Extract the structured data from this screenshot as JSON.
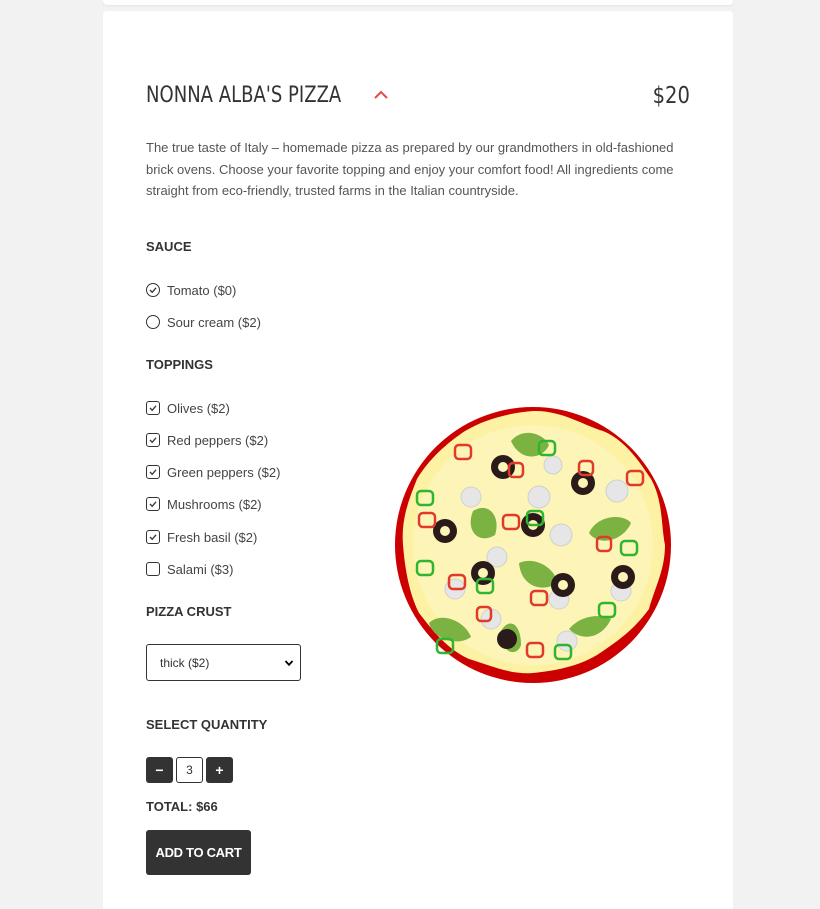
{
  "product": {
    "title": "NONNA ALBA'S PIZZA",
    "price": "$20",
    "description": "The true taste of Italy – homemade pizza as prepared by our grandmothers in old-fashioned brick ovens. Choose your favorite topping and enjoy your comfort food! All ingredients come straight from eco-friendly, trusted farms in the Italian countryside."
  },
  "sauce": {
    "label": "SAUCE",
    "options": [
      {
        "label": "Tomato ($0)",
        "selected": true
      },
      {
        "label": "Sour cream ($2)",
        "selected": false
      }
    ]
  },
  "toppings": {
    "label": "TOPPINGS",
    "options": [
      {
        "label": "Olives ($2)",
        "checked": true
      },
      {
        "label": "Red peppers ($2)",
        "checked": true
      },
      {
        "label": "Green peppers ($2)",
        "checked": true
      },
      {
        "label": "Mushrooms ($2)",
        "checked": true
      },
      {
        "label": "Fresh basil ($2)",
        "checked": true
      },
      {
        "label": "Salami ($3)",
        "checked": false
      }
    ]
  },
  "crust": {
    "label": "PIZZA CRUST",
    "selected": "thick ($2)"
  },
  "quantity": {
    "label": "SELECT QUANTITY",
    "value": "3",
    "minus": "−",
    "plus": "+"
  },
  "total": "TOTAL: $66",
  "add_to_cart": "ADD TO CART",
  "colors": {
    "accent": "#e8474c",
    "dark": "#333333",
    "crust_red": "#cc0000",
    "cheese": "#fdf5b0"
  }
}
